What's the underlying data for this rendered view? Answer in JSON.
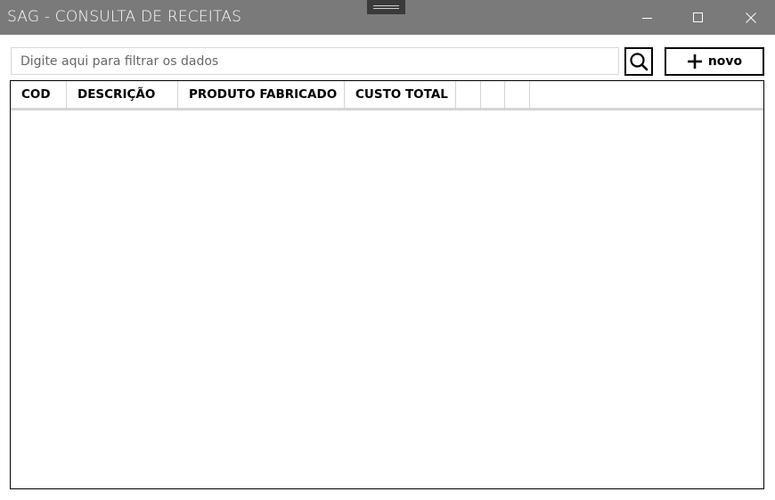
{
  "window": {
    "title": "SAG - CONSULTA DE RECEITAS",
    "titlebar_color": "#7a7a7a",
    "controls": [
      "minimize-icon",
      "maximize-icon",
      "close-icon"
    ]
  },
  "toolbar": {
    "search_placeholder": "Digite aqui para filtrar os dados",
    "search_value": "",
    "search_icon": "search-icon",
    "new_label": "novo",
    "new_icon": "plus-icon"
  },
  "grid": {
    "columns": [
      "COD",
      "DESCRIÇÃO",
      "PRODUTO FABRICADO",
      "CUSTO TOTAL",
      "",
      "",
      ""
    ],
    "rows": []
  }
}
